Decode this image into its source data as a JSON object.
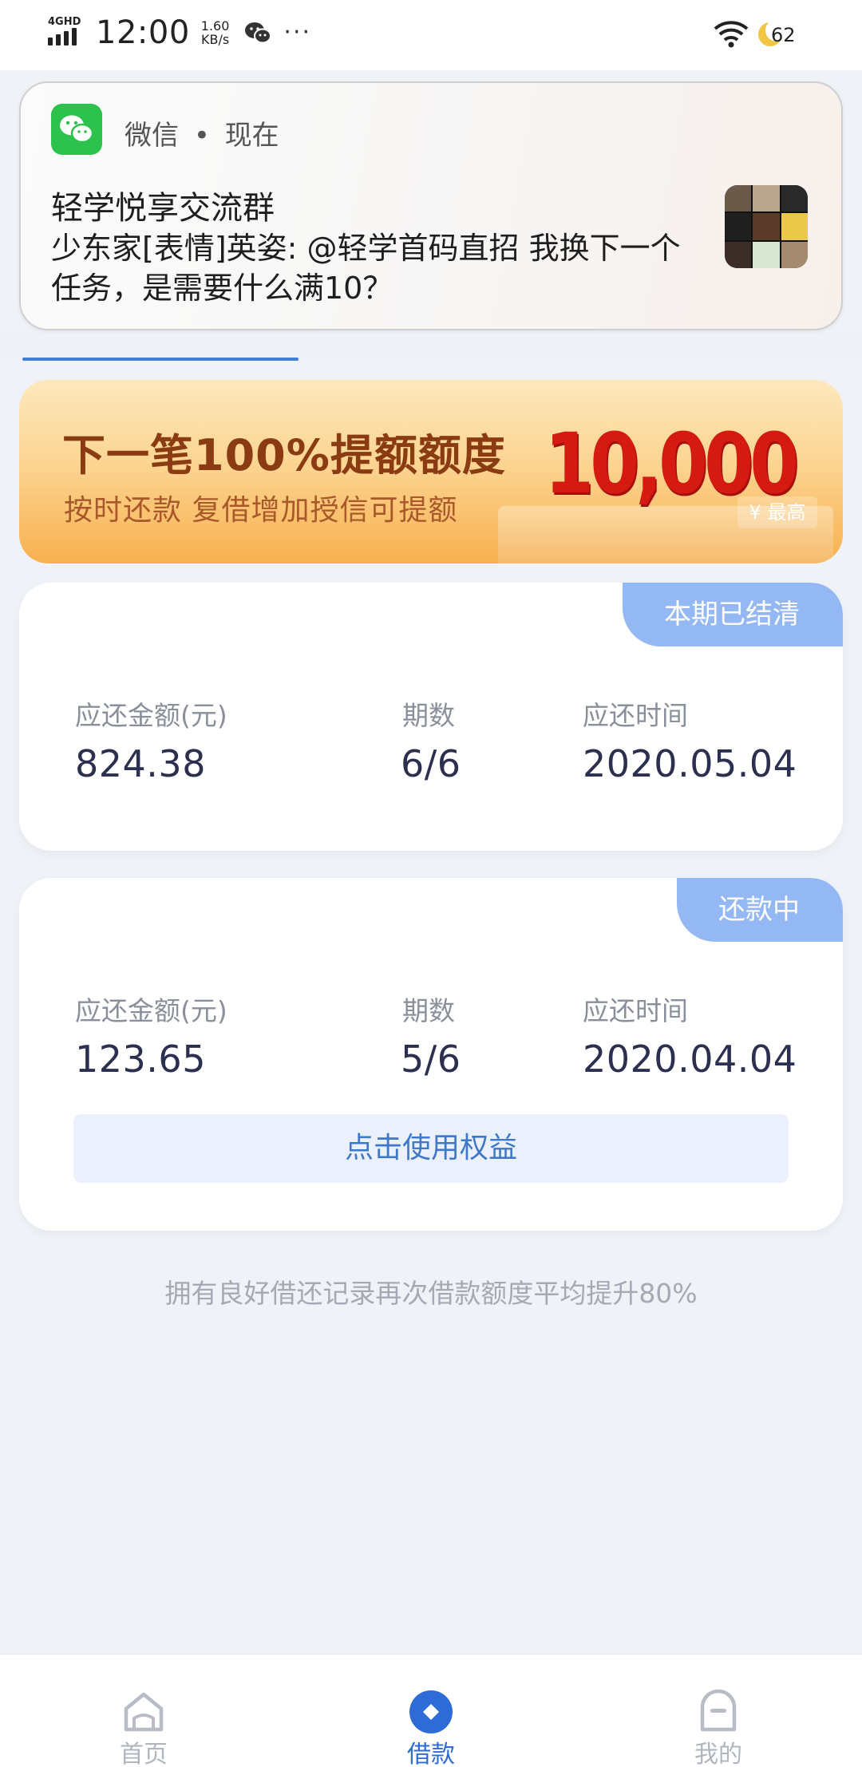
{
  "status_bar": {
    "network": "4GHD",
    "time": "12:00",
    "speed_value": "1.60",
    "speed_unit": "KB/s",
    "more": "···",
    "battery": "62"
  },
  "notification": {
    "app_name": "微信",
    "separator": "•",
    "time": "现在",
    "title": "轻学悦享交流群",
    "message": "少东家[表情]英姿: @轻学首码直招 我换下一个任务，是需要什么满10？"
  },
  "page_progress": 0.32,
  "banner": {
    "title": "下一笔100%提额额度",
    "subtitle": "按时还款  复借增加授信可提额",
    "amount": "10,000",
    "tag": "¥ 最高"
  },
  "cards": [
    {
      "status": "本期已结清",
      "amount_label": "应还金额(元)",
      "amount": "824.38",
      "period_label": "期数",
      "period": "6/6",
      "date_label": "应还时间",
      "date": "2020.05.04"
    },
    {
      "status": "还款中",
      "amount_label": "应还金额(元)",
      "amount": "123.65",
      "period_label": "期数",
      "period": "5/6",
      "date_label": "应还时间",
      "date": "2020.04.04",
      "action": "点击使用权益"
    }
  ],
  "footer_note": "拥有良好借还记录再次借款额度平均提升80%",
  "tabs": [
    {
      "label": "首页",
      "icon": "home-icon",
      "active": false
    },
    {
      "label": "借款",
      "icon": "loan-icon",
      "active": true
    },
    {
      "label": "我的",
      "icon": "profile-icon",
      "active": false
    }
  ],
  "colors": {
    "accent": "#2e6bd7",
    "badge": "#94b8f4",
    "banner_amount": "#d51a12",
    "background": "#eff3f8"
  }
}
